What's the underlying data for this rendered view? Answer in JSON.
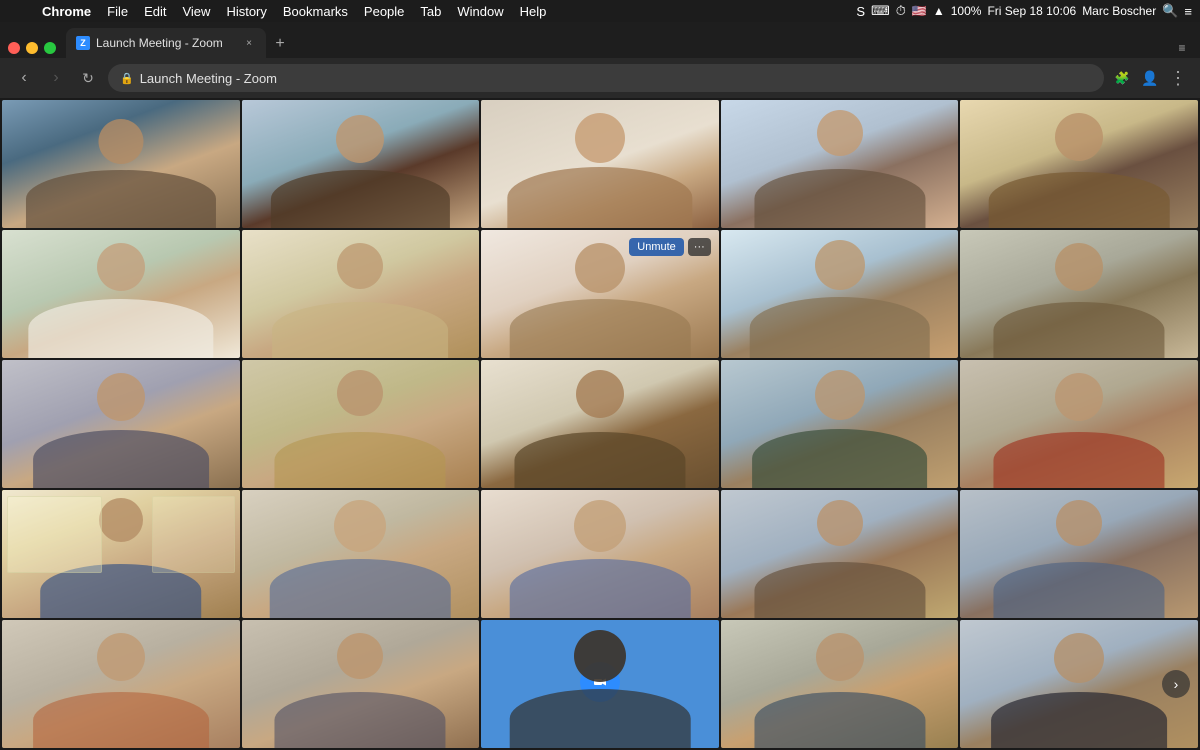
{
  "menubar": {
    "apple_symbol": "",
    "app_name": "Chrome",
    "menus": [
      "File",
      "Edit",
      "View",
      "History",
      "Bookmarks",
      "People",
      "Tab",
      "Window",
      "Help"
    ],
    "right": {
      "skype_icon": "S",
      "translation_icon": "⌨",
      "time_machine_icon": "⏱",
      "flag": "🇺🇸",
      "wifi": "wifi",
      "battery": "100%",
      "battery_icon": "🔋",
      "datetime": "Fri Sep 18  10:06",
      "user": "Marc Boscher",
      "search_icon": "🔍",
      "control_icon": "≡"
    }
  },
  "browser": {
    "tab": {
      "title": "Launch Meeting - Zoom",
      "favicon": "Z"
    },
    "url": "Launch Meeting - Zoom",
    "window_controls": {
      "close": "×",
      "min": "−",
      "max": "+"
    }
  },
  "zoom": {
    "unmute_button": "Unmute",
    "more_button": "···",
    "next_arrow": "›",
    "cells": [
      {
        "id": "1-1",
        "row": 1,
        "col": 1,
        "active": false
      },
      {
        "id": "1-2",
        "row": 1,
        "col": 2,
        "active": false
      },
      {
        "id": "1-3",
        "row": 1,
        "col": 3,
        "active": false
      },
      {
        "id": "1-4",
        "row": 1,
        "col": 4,
        "active": false
      },
      {
        "id": "1-5",
        "row": 1,
        "col": 5,
        "active": false
      },
      {
        "id": "2-1",
        "row": 2,
        "col": 1,
        "active": false
      },
      {
        "id": "2-2",
        "row": 2,
        "col": 2,
        "active": false
      },
      {
        "id": "2-3",
        "row": 2,
        "col": 3,
        "active": true,
        "has_unmute": true
      },
      {
        "id": "2-4",
        "row": 2,
        "col": 4,
        "active": false
      },
      {
        "id": "2-5",
        "row": 2,
        "col": 5,
        "active": false
      },
      {
        "id": "3-1",
        "row": 3,
        "col": 1,
        "active": false
      },
      {
        "id": "3-2",
        "row": 3,
        "col": 2,
        "active": false
      },
      {
        "id": "3-3",
        "row": 3,
        "col": 3,
        "active": false
      },
      {
        "id": "3-4",
        "row": 3,
        "col": 4,
        "active": false
      },
      {
        "id": "3-5",
        "row": 3,
        "col": 5,
        "active": false
      },
      {
        "id": "4-1",
        "row": 4,
        "col": 1,
        "active": true,
        "has_yellow_border": true
      },
      {
        "id": "4-2",
        "row": 4,
        "col": 2,
        "active": false
      },
      {
        "id": "4-3",
        "row": 4,
        "col": 3,
        "active": false
      },
      {
        "id": "4-4",
        "row": 4,
        "col": 4,
        "active": false
      },
      {
        "id": "4-5",
        "row": 4,
        "col": 5,
        "active": false
      },
      {
        "id": "5-1",
        "row": 5,
        "col": 1,
        "active": false
      },
      {
        "id": "5-2",
        "row": 5,
        "col": 2,
        "active": false
      },
      {
        "id": "5-3",
        "row": 5,
        "col": 3,
        "active": false,
        "is_zoom_logo": true
      },
      {
        "id": "5-4",
        "row": 5,
        "col": 4,
        "active": false
      },
      {
        "id": "5-5",
        "row": 5,
        "col": 5,
        "active": false
      }
    ]
  }
}
